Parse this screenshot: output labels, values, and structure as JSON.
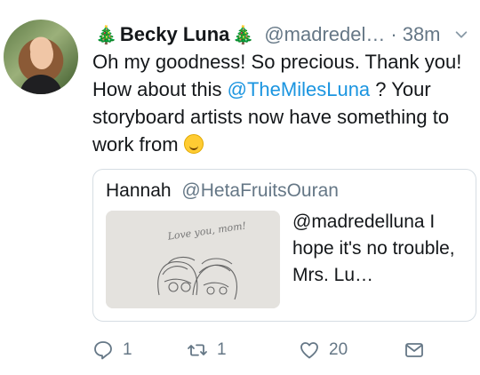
{
  "tweet": {
    "author_name": "Becky Luna",
    "author_handle": "@madredel…",
    "separator": "·",
    "time": "38m",
    "body_parts": [
      "Oh my goodness!  So precious. Thank you!  How about this ",
      "@TheMilesLuna",
      " ? Your storyboard artists now have something to work from "
    ]
  },
  "quoted": {
    "author_name": "Hannah",
    "author_handle": "@HetaFruitsOuran",
    "text": "@madredelluna I hope it's no trouble, Mrs. Lu…",
    "image_caption": "Love you, mom!"
  },
  "actions": {
    "reply_count": "1",
    "retweet_count": "1",
    "like_count": "20"
  },
  "icons": {
    "avatar": "profile-photo",
    "tree": "christmas-tree-icon",
    "chevron": "chevron-down-icon",
    "emoji": "grinning-face-icon",
    "reply": "reply-icon",
    "retweet": "retweet-icon",
    "like": "heart-icon",
    "dm": "envelope-icon"
  },
  "colors": {
    "link": "#1b95e0",
    "secondary": "#657786",
    "text": "#14171a",
    "border": "#d6dde3"
  }
}
